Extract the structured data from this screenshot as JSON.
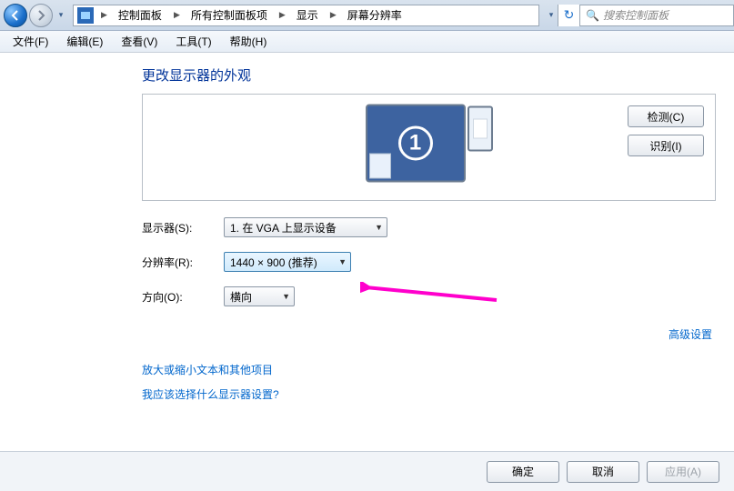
{
  "breadcrumb": {
    "seg1": "控制面板",
    "seg2": "所有控制面板项",
    "seg3": "显示",
    "seg4": "屏幕分辨率"
  },
  "search": {
    "placeholder": "搜索控制面板"
  },
  "menu": {
    "file": "文件(F)",
    "edit": "编辑(E)",
    "view": "查看(V)",
    "tools": "工具(T)",
    "help": "帮助(H)"
  },
  "heading": "更改显示器的外观",
  "monitor": {
    "number": "1"
  },
  "previewButtons": {
    "detect": "检测(C)",
    "identify": "识别(I)"
  },
  "fields": {
    "displayLabel": "显示器(S):",
    "displayValue": "1. 在 VGA 上显示设备",
    "resolutionLabel": "分辨率(R):",
    "resolutionValue": "1440 × 900 (推荐)",
    "orientationLabel": "方向(O):",
    "orientationValue": "横向"
  },
  "links": {
    "advanced": "高级设置",
    "help1": "放大或缩小文本和其他项目",
    "help2": "我应该选择什么显示器设置?"
  },
  "footer": {
    "ok": "确定",
    "cancel": "取消",
    "apply": "应用(A)"
  }
}
